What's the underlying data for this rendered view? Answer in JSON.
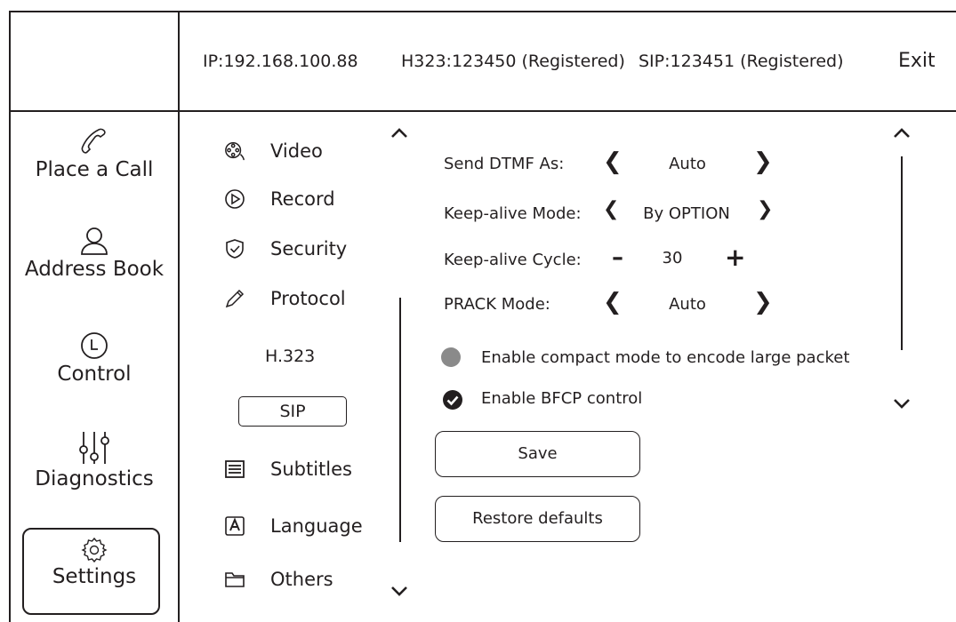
{
  "header": {
    "ip": "IP:192.168.100.88",
    "h323": "H323:123450 (Registered)",
    "sip": "SIP:123451 (Registered)",
    "exit": "Exit"
  },
  "nav": {
    "place_call": "Place a Call",
    "address_book": "Address Book",
    "control": "Control",
    "diagnostics": "Diagnostics",
    "settings": "Settings"
  },
  "menu": {
    "video": "Video",
    "record": "Record",
    "security": "Security",
    "protocol": "Protocol",
    "h323": "H.323",
    "sip": "SIP",
    "subtitles": "Subtitles",
    "language": "Language",
    "others": "Others"
  },
  "settings": {
    "dtmf_label": "Send DTMF As:",
    "dtmf_value": "Auto",
    "keepalive_mode_label": "Keep-alive Mode:",
    "keepalive_mode_value": "By OPTION",
    "keepalive_cycle_label": "Keep-alive Cycle:",
    "keepalive_cycle_value": "30",
    "prack_label": "PRACK Mode:",
    "prack_value": "Auto",
    "compact_label": "Enable compact mode to encode large packet",
    "compact_enabled": false,
    "bfcp_label": "Enable BFCP control",
    "bfcp_enabled": true,
    "save": "Save",
    "restore": "Restore defaults"
  },
  "colors": {
    "ink": "#231f20",
    "radio_off": "#8a8a8a"
  }
}
